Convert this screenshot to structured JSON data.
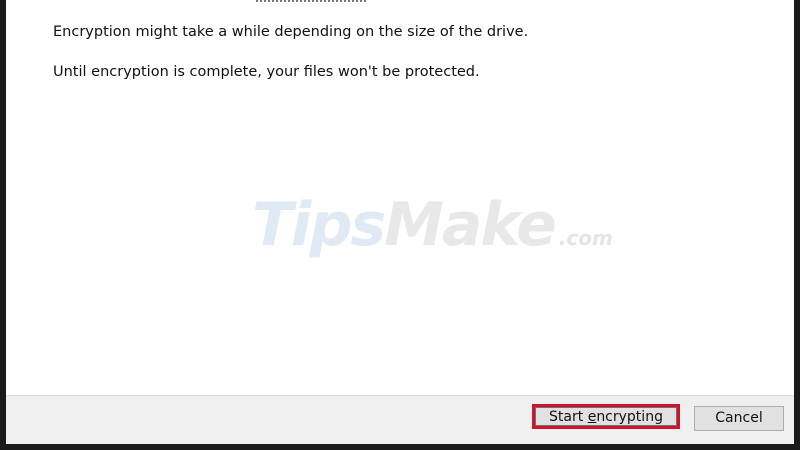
{
  "dialog": {
    "messages": [
      "Encryption might take a while depending on the size of the drive.",
      "Until encryption is complete, your files won't be protected."
    ]
  },
  "watermark": {
    "tips": "Tips",
    "make": "Make",
    "com": ".com"
  },
  "footer": {
    "start_label_pre": "Start ",
    "start_label_accel": "e",
    "start_label_post": "ncrypting",
    "cancel_label": "Cancel"
  },
  "colors": {
    "highlight": "#d0122b",
    "footer_bg": "#f0f0f0",
    "button_bg": "#e1e1e1"
  }
}
